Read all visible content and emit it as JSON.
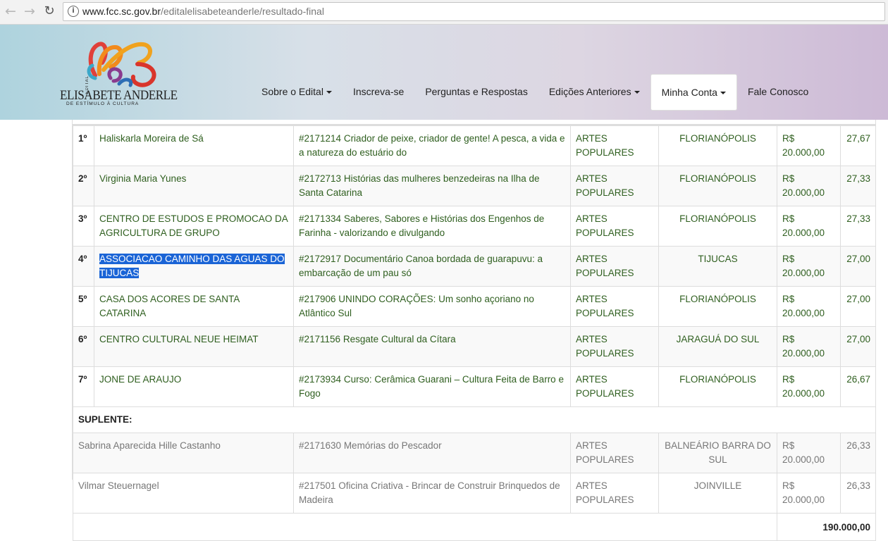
{
  "browser": {
    "back_icon": "back-arrow-icon",
    "forward_icon": "forward-arrow-icon",
    "reload_icon": "reload-icon",
    "url_host": "www.fcc.sc.gov.br",
    "url_path": "/editalelisabeteanderle/resultado-final"
  },
  "logo": {
    "edital": "EDITAL",
    "name": "ELISABETE ANDERLE",
    "subtitle": "DE ESTÍMULO À CULTURA"
  },
  "menu": {
    "items": [
      {
        "label": "Sobre o Edital",
        "dropdown": true
      },
      {
        "label": "Inscreva-se",
        "dropdown": false
      },
      {
        "label": "Perguntas e Respostas",
        "dropdown": false
      },
      {
        "label": "Edições Anteriores",
        "dropdown": true
      },
      {
        "label": "Minha Conta",
        "dropdown": true
      },
      {
        "label": "Fale Conosco",
        "dropdown": false
      }
    ]
  },
  "results": {
    "winners": [
      {
        "rank": "1º",
        "name": "Haliskarla Moreira de Sá",
        "project": "#2171214 Criador de peixe, criador de gente! A pesca, a vida e a natureza do estuário do",
        "area": "ARTES POPULARES",
        "city": "FLORIANÓPOLIS",
        "value": "R$ 20.000,00",
        "score": "27,67"
      },
      {
        "rank": "2º",
        "name": "Virginia Maria Yunes",
        "project": "#2172713 Histórias das mulheres benzedeiras na Ilha de Santa Catarina",
        "area": "ARTES POPULARES",
        "city": "FLORIANÓPOLIS",
        "value": "R$ 20.000,00",
        "score": "27,33"
      },
      {
        "rank": "3º",
        "name": "CENTRO DE ESTUDOS E PROMOCAO DA AGRICULTURA DE GRUPO",
        "project": "#2171334 Saberes, Sabores e Histórias dos Engenhos de Farinha - valorizando e divulgando",
        "area": "ARTES POPULARES",
        "city": "FLORIANÓPOLIS",
        "value": "R$ 20.000,00",
        "score": "27,33"
      },
      {
        "rank": "4º",
        "name": "ASSOCIACAO CAMINHO DAS AGUAS DO TIJUCAS",
        "project": "#2172917 Documentário Canoa bordada de guarapuvu: a embarcação de um pau só",
        "area": "ARTES POPULARES",
        "city": "TIJUCAS",
        "value": "R$ 20.000,00",
        "score": "27,00"
      },
      {
        "rank": "5º",
        "name": "CASA DOS ACORES DE SANTA CATARINA",
        "project": "#217906 UNINDO CORAÇÕES: Um sonho açoriano no Atlântico Sul",
        "area": "ARTES POPULARES",
        "city": "FLORIANÓPOLIS",
        "value": "R$ 20.000,00",
        "score": "27,00"
      },
      {
        "rank": "6º",
        "name": "CENTRO CULTURAL NEUE HEIMAT",
        "project": "#2171156 Resgate Cultural da Cítara",
        "area": "ARTES POPULARES",
        "city": "JARAGUÁ DO SUL",
        "value": "R$ 20.000,00",
        "score": "27,00"
      },
      {
        "rank": "7º",
        "name": "JONE DE ARAUJO",
        "project": "#2173934 Curso: Cerâmica Guarani – Cultura Feita de Barro e Fogo",
        "area": "ARTES POPULARES",
        "city": "FLORIANÓPOLIS",
        "value": "R$ 20.000,00",
        "score": "26,67"
      }
    ],
    "suplente_label": "SUPLENTE:",
    "suplentes": [
      {
        "name": "Sabrina Aparecida Hille Castanho",
        "project": "#2171630 Memórias do Pescador",
        "area": "ARTES POPULARES",
        "city": "BALNEÁRIO BARRA DO SUL",
        "value": "R$ 20.000,00",
        "score": "26,33"
      },
      {
        "name": "Vilmar Steuernagel",
        "project": "#217501 Oficina Criativa - Brincar de Construir Brinquedos de Madeira",
        "area": "ARTES POPULARES",
        "city": "JOINVILLE",
        "value": "R$ 20.000,00",
        "score": "26,33"
      }
    ],
    "total": "190.000,00"
  }
}
